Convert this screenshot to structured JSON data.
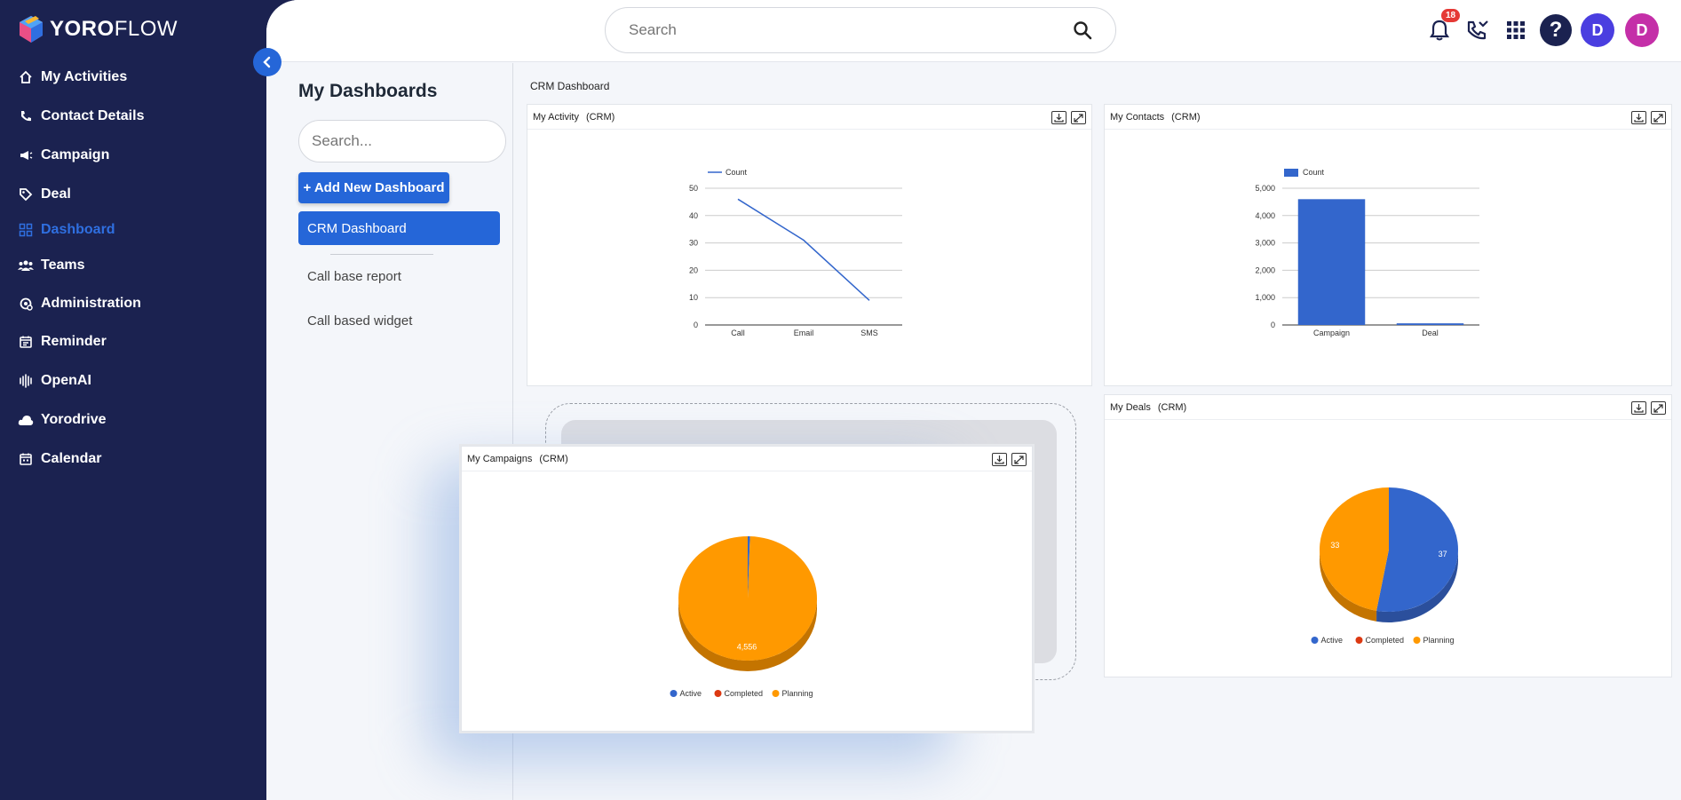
{
  "app": {
    "brand_bold": "YORO",
    "brand_light": "FLOW"
  },
  "sidebar": {
    "items": [
      {
        "label": "My Activities",
        "icon": "home-icon",
        "active": false
      },
      {
        "label": "Contact Details",
        "icon": "contact-phone-icon",
        "active": false
      },
      {
        "label": "Campaign",
        "icon": "megaphone-icon",
        "active": false
      },
      {
        "label": "Deal",
        "icon": "tag-icon",
        "active": false
      },
      {
        "label": "Dashboard",
        "icon": "dashboard-grid-icon",
        "active": true
      },
      {
        "label": "Teams",
        "icon": "people-icon",
        "active": false
      },
      {
        "label": "Administration",
        "icon": "admin-gear-icon",
        "active": false
      },
      {
        "label": "Reminder",
        "icon": "reminder-calendar-icon",
        "active": false
      },
      {
        "label": "OpenAI",
        "icon": "openai-icon",
        "active": false
      },
      {
        "label": "Yorodrive",
        "icon": "cloud-drive-icon",
        "active": false
      },
      {
        "label": "Calendar",
        "icon": "calendar-icon",
        "active": false
      }
    ]
  },
  "topbar": {
    "search_placeholder": "Search",
    "notification_count": "18",
    "avatars": [
      {
        "letter": "D",
        "color": "#4a3ee0"
      },
      {
        "letter": "D",
        "color": "#c42fa8"
      }
    ]
  },
  "dashboards": {
    "title": "My Dashboards",
    "search_placeholder": "Search...",
    "add_label": "+ Add New Dashboard",
    "items": [
      "CRM Dashboard",
      "Call base report",
      "Call based widget"
    ]
  },
  "canvas": {
    "title": "CRM Dashboard"
  },
  "colors": {
    "accent": "#2566d8",
    "sidebar": "#1b2250",
    "blue": "#3366cc",
    "red": "#dc3912",
    "orange": "#ff9900"
  },
  "widgets": {
    "activity": {
      "title": "My Activity",
      "tag": "(CRM)"
    },
    "contacts": {
      "title": "My Contacts",
      "tag": "(CRM)"
    },
    "deals": {
      "title": "My Deals",
      "tag": "(CRM)"
    },
    "campaigns": {
      "title": "My Campaigns",
      "tag": "(CRM)"
    }
  },
  "chart_data": [
    {
      "id": "activity",
      "type": "line",
      "categories": [
        "Call",
        "Email",
        "SMS"
      ],
      "series": [
        {
          "name": "Count",
          "values": [
            46,
            31,
            9
          ]
        }
      ],
      "ylim": [
        0,
        50
      ],
      "yticks": [
        "0",
        "10",
        "20",
        "30",
        "40",
        "50"
      ],
      "legend": "top-left"
    },
    {
      "id": "contacts",
      "type": "bar",
      "categories": [
        "Campaign",
        "Deal"
      ],
      "series": [
        {
          "name": "Count",
          "values": [
            4600,
            60
          ]
        }
      ],
      "ylim": [
        0,
        5000
      ],
      "yticks": [
        "0",
        "1,000",
        "2,000",
        "3,000",
        "4,000",
        "5,000"
      ],
      "legend": "top-left"
    },
    {
      "id": "deals",
      "type": "pie",
      "labels": [
        "Active",
        "Completed",
        "Planning"
      ],
      "values": [
        37,
        0,
        33
      ],
      "data_labels": [
        "37",
        "",
        "33"
      ],
      "legend": "bottom"
    },
    {
      "id": "campaigns",
      "type": "pie",
      "labels": [
        "Active",
        "Completed",
        "Planning"
      ],
      "values": [
        25,
        0,
        4556
      ],
      "data_labels": [
        "",
        "",
        "4,556"
      ],
      "legend": "bottom"
    }
  ]
}
